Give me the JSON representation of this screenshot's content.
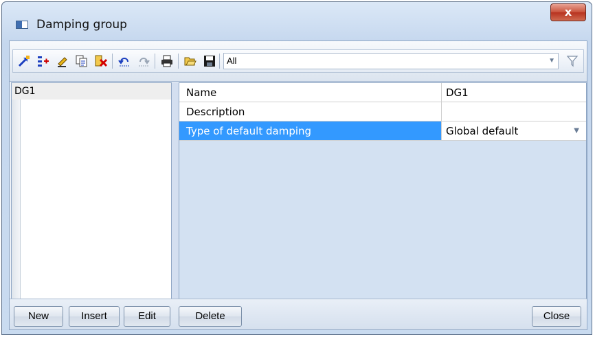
{
  "window": {
    "title": "Damping group",
    "close_glyph": "x"
  },
  "toolbar": {
    "icons": [
      "new-item-icon",
      "attributes-icon",
      "edit-pencil-icon",
      "copy-icon",
      "delete-red-icon",
      "undo-icon",
      "redo-icon",
      "print-icon",
      "open-folder-icon",
      "save-disk-icon",
      "filter-funnel-icon"
    ],
    "filter_value": "All"
  },
  "list": {
    "items": [
      "DG1"
    ]
  },
  "properties": [
    {
      "name": "Name",
      "value": "DG1"
    },
    {
      "name": "Description",
      "value": ""
    },
    {
      "name": "Type of default damping",
      "value": "Global default",
      "selected": true
    }
  ],
  "buttons": {
    "new": "New",
    "insert": "Insert",
    "edit": "Edit",
    "delete": "Delete",
    "close": "Close"
  },
  "colors": {
    "selection": "#3399ff",
    "panel_bg": "#d3e1f2",
    "close_red": "#c9513a"
  }
}
